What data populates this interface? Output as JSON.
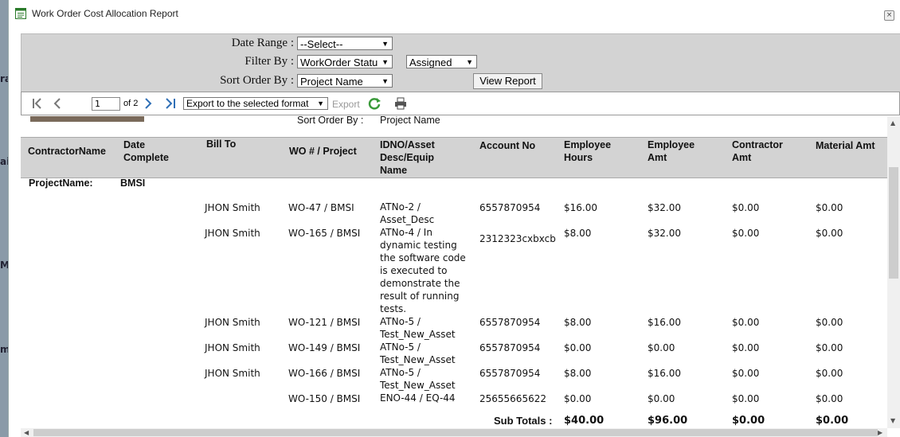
{
  "window": {
    "title": "Work Order Cost Allocation Report",
    "close": "×"
  },
  "background_letters": [
    "ra",
    "ai",
    "M",
    "m"
  ],
  "filters": {
    "date_range_label": "Date Range :",
    "date_range_value": "--Select--",
    "filter_by_label": "Filter By :",
    "filter_by_value": "WorkOrder Statu",
    "filter_by_sub_value": "Assigned",
    "sort_order_label": "Sort Order By :",
    "sort_order_value": "Project Name",
    "view_report": "View Report"
  },
  "toolbar": {
    "page_current": "1",
    "page_total": "of 2",
    "export_format": "Export to the selected format",
    "export_label": "Export"
  },
  "report": {
    "sort_order_caption": "Sort Order By :",
    "sort_order_value": "Project Name",
    "headers": [
      "ContractorName",
      "Date\nComplete",
      "Bill To",
      "WO # / Project",
      "IDNO/Asset\nDesc/Equip\nName",
      "Account No",
      "Employee\nHours",
      "Employee\nAmt",
      "Contractor\nAmt",
      "Material Amt"
    ],
    "group_label": "ProjectName:",
    "group_value": "BMSI",
    "rows": [
      {
        "bill_to": "JHON Smith",
        "wo": "WO-47 / BMSI",
        "asset": "ATNo-2 /\nAsset_Desc",
        "account": "6557870954",
        "hours": "$16.00",
        "emp_amt": "$32.00",
        "contr_amt": "$0.00",
        "mat_amt": "$0.00"
      },
      {
        "bill_to": "JHON Smith",
        "wo": "WO-165 / BMSI",
        "asset": "ATNo-4 / In\ndynamic testing\nthe software code\nis executed to\ndemonstrate the\nresult of running\ntests.",
        "account": "2312323cxbxcb",
        "hours": "$8.00",
        "emp_amt": "$32.00",
        "contr_amt": "$0.00",
        "mat_amt": "$0.00"
      },
      {
        "bill_to": "JHON Smith",
        "wo": "WO-121 / BMSI",
        "asset": "ATNo-5 /\nTest_New_Asset",
        "account": "6557870954",
        "hours": "$8.00",
        "emp_amt": "$16.00",
        "contr_amt": "$0.00",
        "mat_amt": "$0.00"
      },
      {
        "bill_to": "JHON Smith",
        "wo": "WO-149 / BMSI",
        "asset": "ATNo-5 /\nTest_New_Asset",
        "account": "6557870954",
        "hours": "$0.00",
        "emp_amt": "$0.00",
        "contr_amt": "$0.00",
        "mat_amt": "$0.00"
      },
      {
        "bill_to": "JHON Smith",
        "wo": "WO-166 / BMSI",
        "asset": "ATNo-5 /\nTest_New_Asset",
        "account": "6557870954",
        "hours": "$8.00",
        "emp_amt": "$16.00",
        "contr_amt": "$0.00",
        "mat_amt": "$0.00"
      },
      {
        "bill_to": "",
        "wo": "WO-150 / BMSI",
        "asset": "ENO-44 / EQ-44",
        "account": "25655665622",
        "hours": "$0.00",
        "emp_amt": "$0.00",
        "contr_amt": "$0.00",
        "mat_amt": "$0.00"
      }
    ],
    "subtotal_label": "Sub Totals :",
    "subtotals": {
      "hours": "$40.00",
      "emp_amt": "$96.00",
      "contr_amt": "$0.00",
      "mat_amt": "$0.00"
    }
  },
  "colors": {
    "panel_bg": "#d3d3d3",
    "header_bg": "#d3d3d3",
    "nav_blue": "#2f6fb6",
    "refresh_green": "#3a9a3a"
  }
}
